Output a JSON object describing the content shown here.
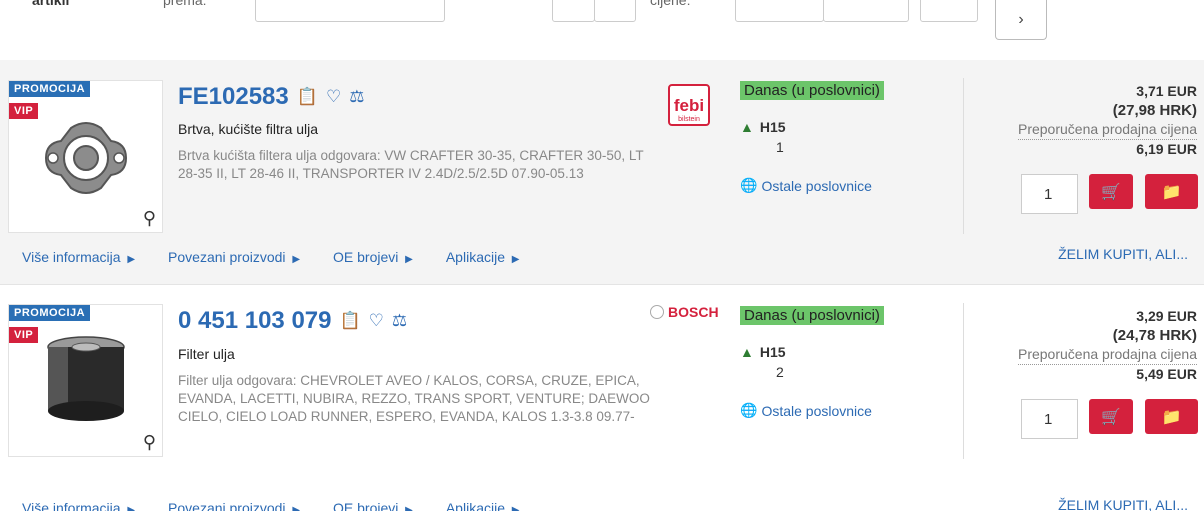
{
  "topbar": {
    "label_a": "artikli",
    "label_b": "prema:",
    "label_c": "cijene:",
    "next_label": "›"
  },
  "products": [
    {
      "badge_promo": "PROMOCIJA",
      "badge_vip": "VIP",
      "code": "FE102583",
      "name": "Brtva, kućište filtra ulja",
      "description": "Brtva kućišta filtera ulja odgovara: VW CRAFTER 30-35, CRAFTER 30-50, LT 28-35 II, LT 28-46 II, TRANSPORTER IV 2.4D/2.5/2.5D 07.90-05.13",
      "brand": "febi",
      "brand_sub": "bilstein",
      "stock": "Danas (u poslovnici)",
      "location": "H15",
      "location_qty": "1",
      "other_stores": "Ostale poslovnice",
      "price_eur": "3,71 EUR",
      "price_hrk": "(27,98 HRK)",
      "recommended_label": "Preporučena prodajna cijena",
      "recommended_price": "6,19 EUR",
      "quantity": "1",
      "links": [
        "Više informacija",
        "Povezani proizvodi",
        "OE brojevi",
        "Aplikacije"
      ],
      "buy_label": "ŽELIM KUPITI, ALI..."
    },
    {
      "badge_promo": "PROMOCIJA",
      "badge_vip": "VIP",
      "code": "0 451 103 079",
      "name": "Filter ulja",
      "description": "Filter ulja odgovara: CHEVROLET AVEO / KALOS, CORSA, CRUZE, EPICA, EVANDA, LACETTI, NUBIRA, REZZO, TRANS SPORT, VENTURE; DAEWOO CIELO, CIELO LOAD RUNNER, ESPERO, EVANDA, KALOS 1.3-3.8 09.77-",
      "brand": "BOSCH",
      "stock": "Danas (u poslovnici)",
      "location": "H15",
      "location_qty": "2",
      "other_stores": "Ostale poslovnice",
      "price_eur": "3,29 EUR",
      "price_hrk": "(24,78 HRK)",
      "recommended_label": "Preporučena prodajna cijena",
      "recommended_price": "5,49 EUR",
      "quantity": "1",
      "links": [
        "Više informacija",
        "Povezani proizvodi",
        "OE brojevi",
        "Aplikacije"
      ],
      "buy_label": "ŽELIM KUPITI, ALI..."
    }
  ],
  "icons": {
    "copy": "clipboard-icon",
    "favorite": "heart-icon",
    "compare": "scale-icon",
    "zoom": "magnifier-icon",
    "cart": "cart-icon",
    "folder": "folder-add-icon",
    "warehouse": "warehouse-icon",
    "stores": "globe-pin-icon"
  },
  "colors": {
    "accent_blue": "#2c6ab3",
    "promo_blue": "#2a6fb5",
    "red": "#d4213d",
    "stock_green": "#6cc56a"
  }
}
